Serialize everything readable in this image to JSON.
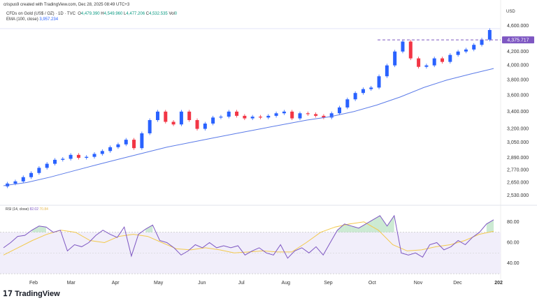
{
  "credit": "crispus9 created with TradingView.com, Dec 28, 2025 08:49 UTC+3",
  "legend": {
    "symbol": "CFDs on Gold (US$ / OZ) · 1D · TVC",
    "o_label": "O",
    "o": "4,479.390",
    "h_label": "H",
    "h": "4,549.960",
    "l_label": "L",
    "l": "4,477.206",
    "c_label": "C",
    "c": "4,532.535",
    "vol_label": "Vol",
    "vol": "0",
    "ema_label": "EMA (100, close)",
    "ema": "3,957.234",
    "rsi_label": "RSI (14, close)",
    "rsi": "82.02",
    "rsi_ma": "70.84"
  },
  "currency": "USD",
  "brand": "TradingView",
  "colors": {
    "up": "#2962ff",
    "down": "#f23645",
    "ema": "#5b7be8",
    "rsi": "#7e57c2",
    "rsi_ma": "#f2c94c",
    "tag": "#7e57c2"
  },
  "chart_data": {
    "type": "candlestick",
    "title": "CFDs on Gold (US$ / OZ) · 1D · TVC",
    "yscale": "log",
    "ylim": [
      2470,
      4700
    ],
    "yticks": [
      "4,600.000",
      "4,200.000",
      "4,000.000",
      "3,800.000",
      "3,600.000",
      "3,400.000",
      "3,200.000",
      "3,050.000",
      "2,890.000",
      "2,770.000",
      "2,650.000",
      "2,530.000"
    ],
    "ytick_values": [
      4600,
      4200,
      4000,
      3800,
      3600,
      3400,
      3200,
      3050,
      2890,
      2770,
      2650,
      2530
    ],
    "price_line": {
      "label": "4,375.717",
      "value": 4375.717
    },
    "xticks": [
      "Feb",
      "Mar",
      "Apr",
      "May",
      "Jun",
      "Jul",
      "Aug",
      "Sep",
      "Oct",
      "Nov",
      "Dec",
      "202"
    ],
    "xtick_pos": [
      0.068,
      0.144,
      0.234,
      0.321,
      0.409,
      0.489,
      0.579,
      0.665,
      0.754,
      0.847,
      0.927,
      1.01
    ],
    "closes": [
      2640,
      2660,
      2700,
      2740,
      2790,
      2830,
      2870,
      2880,
      2920,
      2890,
      2900,
      2930,
      2960,
      3000,
      3030,
      3080,
      2990,
      3150,
      3300,
      3400,
      3280,
      3250,
      3400,
      3300,
      3200,
      3260,
      3330,
      3340,
      3400,
      3350,
      3320,
      3340,
      3330,
      3350,
      3380,
      3400,
      3320,
      3380,
      3370,
      3350,
      3330,
      3380,
      3450,
      3550,
      3630,
      3680,
      3700,
      3850,
      4000,
      4200,
      4350,
      4100,
      3980,
      4000,
      4100,
      4050,
      4150,
      4200,
      4230,
      4300,
      4380,
      4530
    ],
    "ema": [
      2620,
      2650,
      2700,
      2760,
      2820,
      2880,
      2940,
      3000,
      3050,
      3100,
      3150,
      3200,
      3250,
      3300,
      3340,
      3400,
      3480,
      3580,
      3700,
      3800,
      3880,
      3957
    ],
    "rsi": {
      "ylim": [
        28,
        92
      ],
      "yticks": [
        "80.00",
        "60.00",
        "40.00"
      ],
      "ytick_values": [
        80,
        60,
        40
      ],
      "bands": [
        70,
        30
      ],
      "values": [
        55,
        60,
        66,
        67,
        72,
        76,
        75,
        70,
        72,
        52,
        58,
        56,
        60,
        67,
        72,
        68,
        65,
        75,
        47,
        68,
        73,
        77,
        62,
        60,
        55,
        48,
        52,
        58,
        55,
        60,
        55,
        57,
        55,
        57,
        48,
        52,
        55,
        50,
        48,
        58,
        45,
        52,
        55,
        50,
        56,
        48,
        60,
        72,
        78,
        76,
        74,
        78,
        82,
        86,
        76,
        86,
        50,
        48,
        50,
        46,
        58,
        60,
        53,
        56,
        62,
        58,
        65,
        70,
        78,
        82
      ],
      "ma": [
        48,
        55,
        62,
        68,
        72,
        70,
        62,
        60,
        66,
        68,
        66,
        60,
        54,
        53,
        55,
        53,
        50,
        51,
        52,
        51,
        51,
        60,
        70,
        75,
        78,
        80,
        72,
        58,
        52,
        53,
        56,
        58,
        62,
        68,
        71
      ]
    }
  }
}
